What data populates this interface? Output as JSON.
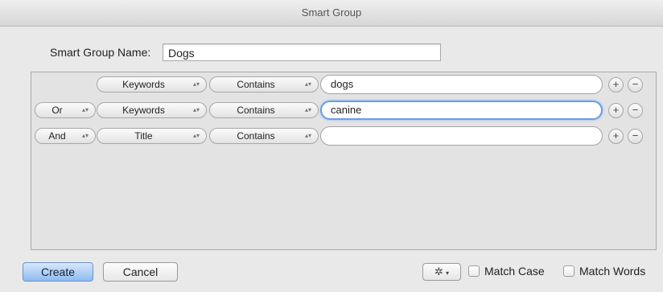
{
  "window": {
    "title": "Smart Group"
  },
  "name_field": {
    "label": "Smart Group Name:",
    "value": "Dogs"
  },
  "criteria": [
    {
      "conjunction": "",
      "field": "Keywords",
      "operator": "Contains",
      "value": "dogs",
      "focused": false
    },
    {
      "conjunction": "Or",
      "field": "Keywords",
      "operator": "Contains",
      "value": "canine",
      "focused": true
    },
    {
      "conjunction": "And",
      "field": "Title",
      "operator": "Contains",
      "value": "",
      "focused": false
    }
  ],
  "row_buttons": {
    "add": "+",
    "remove": "−"
  },
  "footer": {
    "create_label": "Create",
    "cancel_label": "Cancel",
    "gear_icon": "gear-icon",
    "gear_glyph": "✲",
    "caret_glyph": "▾",
    "match_case_label": "Match Case",
    "match_case_checked": false,
    "match_words_label": "Match Words",
    "match_words_checked": false
  },
  "colors": {
    "default_button": "#8fbaf0",
    "focus_ring": "#6a9ee6"
  }
}
